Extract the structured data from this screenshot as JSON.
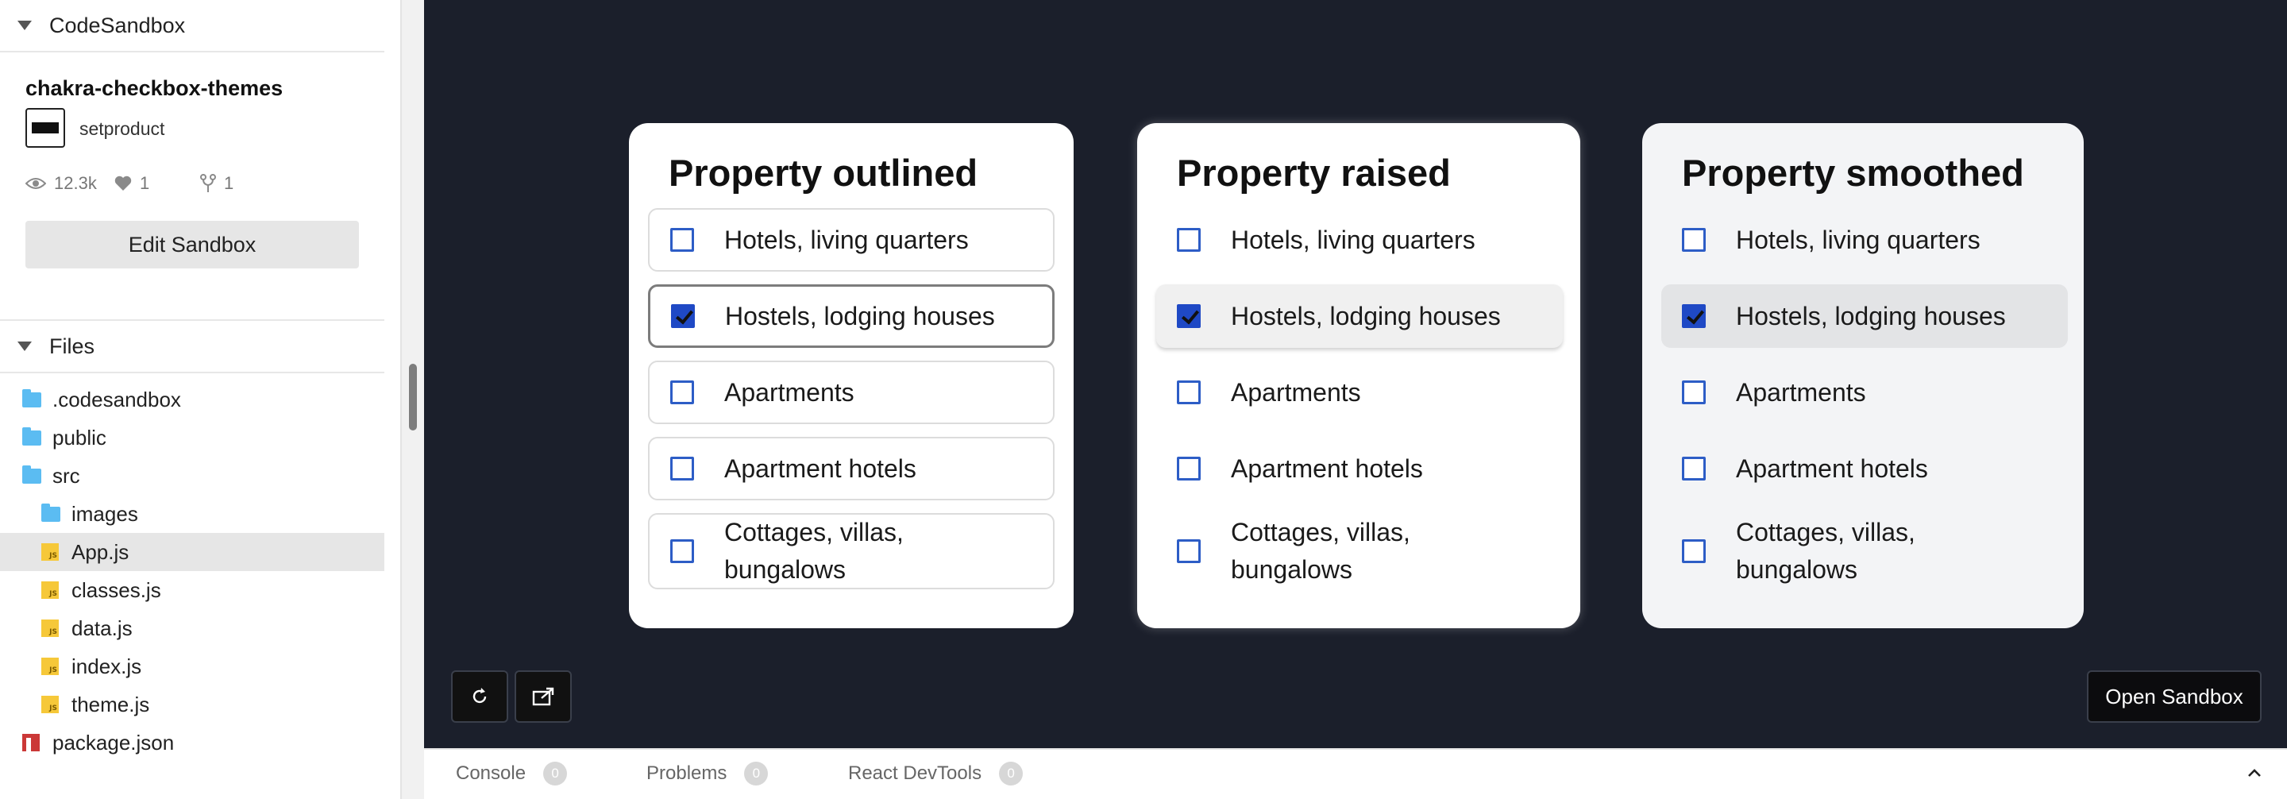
{
  "sidebar": {
    "section_title": "CodeSandbox",
    "project_name": "chakra-checkbox-themes",
    "author": "setproduct",
    "stats": {
      "views": "12.3k",
      "likes": "1",
      "forks": "1"
    },
    "edit_button": "Edit Sandbox",
    "files_title": "Files",
    "files": [
      {
        "name": ".codesandbox",
        "type": "folder"
      },
      {
        "name": "public",
        "type": "folder"
      },
      {
        "name": "src",
        "type": "folder"
      },
      {
        "name": "images",
        "type": "folder"
      },
      {
        "name": "App.js",
        "type": "js",
        "selected": true
      },
      {
        "name": "classes.js",
        "type": "js"
      },
      {
        "name": "data.js",
        "type": "js"
      },
      {
        "name": "index.js",
        "type": "js"
      },
      {
        "name": "theme.js",
        "type": "js"
      },
      {
        "name": "package.json",
        "type": "npm"
      }
    ]
  },
  "preview": {
    "cards": [
      {
        "title": "Property outlined",
        "variant": "outlined",
        "options": [
          {
            "label": "Hotels, living quarters",
            "checked": false
          },
          {
            "label": "Hostels, lodging houses",
            "checked": true
          },
          {
            "label": "Apartments",
            "checked": false
          },
          {
            "label": "Apartment hotels",
            "checked": false
          },
          {
            "label": "Cottages, villas, bungalows",
            "checked": false
          }
        ]
      },
      {
        "title": "Property raised",
        "variant": "raised",
        "options": [
          {
            "label": "Hotels, living quarters",
            "checked": false
          },
          {
            "label": "Hostels, lodging houses",
            "checked": true
          },
          {
            "label": "Apartments",
            "checked": false
          },
          {
            "label": "Apartment hotels",
            "checked": false
          },
          {
            "label": "Cottages, villas, bungalows",
            "checked": false
          }
        ]
      },
      {
        "title": "Property smoothed",
        "variant": "smoothed",
        "options": [
          {
            "label": "Hotels, living quarters",
            "checked": false
          },
          {
            "label": "Hostels, lodging houses",
            "checked": true
          },
          {
            "label": "Apartments",
            "checked": false
          },
          {
            "label": "Apartment hotels",
            "checked": false
          },
          {
            "label": "Cottages, villas, bungalows",
            "checked": false
          }
        ]
      }
    ],
    "tool_icons": [
      "refresh-icon",
      "open-new-window-icon"
    ],
    "open_sandbox": "Open Sandbox",
    "colors": {
      "background": "#1b1f2b",
      "checkbox_accent": "#1f49c5"
    }
  },
  "bottom_bar": {
    "tabs": [
      {
        "label": "Console",
        "count": "0"
      },
      {
        "label": "Problems",
        "count": "0"
      },
      {
        "label": "React DevTools",
        "count": "0"
      }
    ]
  }
}
